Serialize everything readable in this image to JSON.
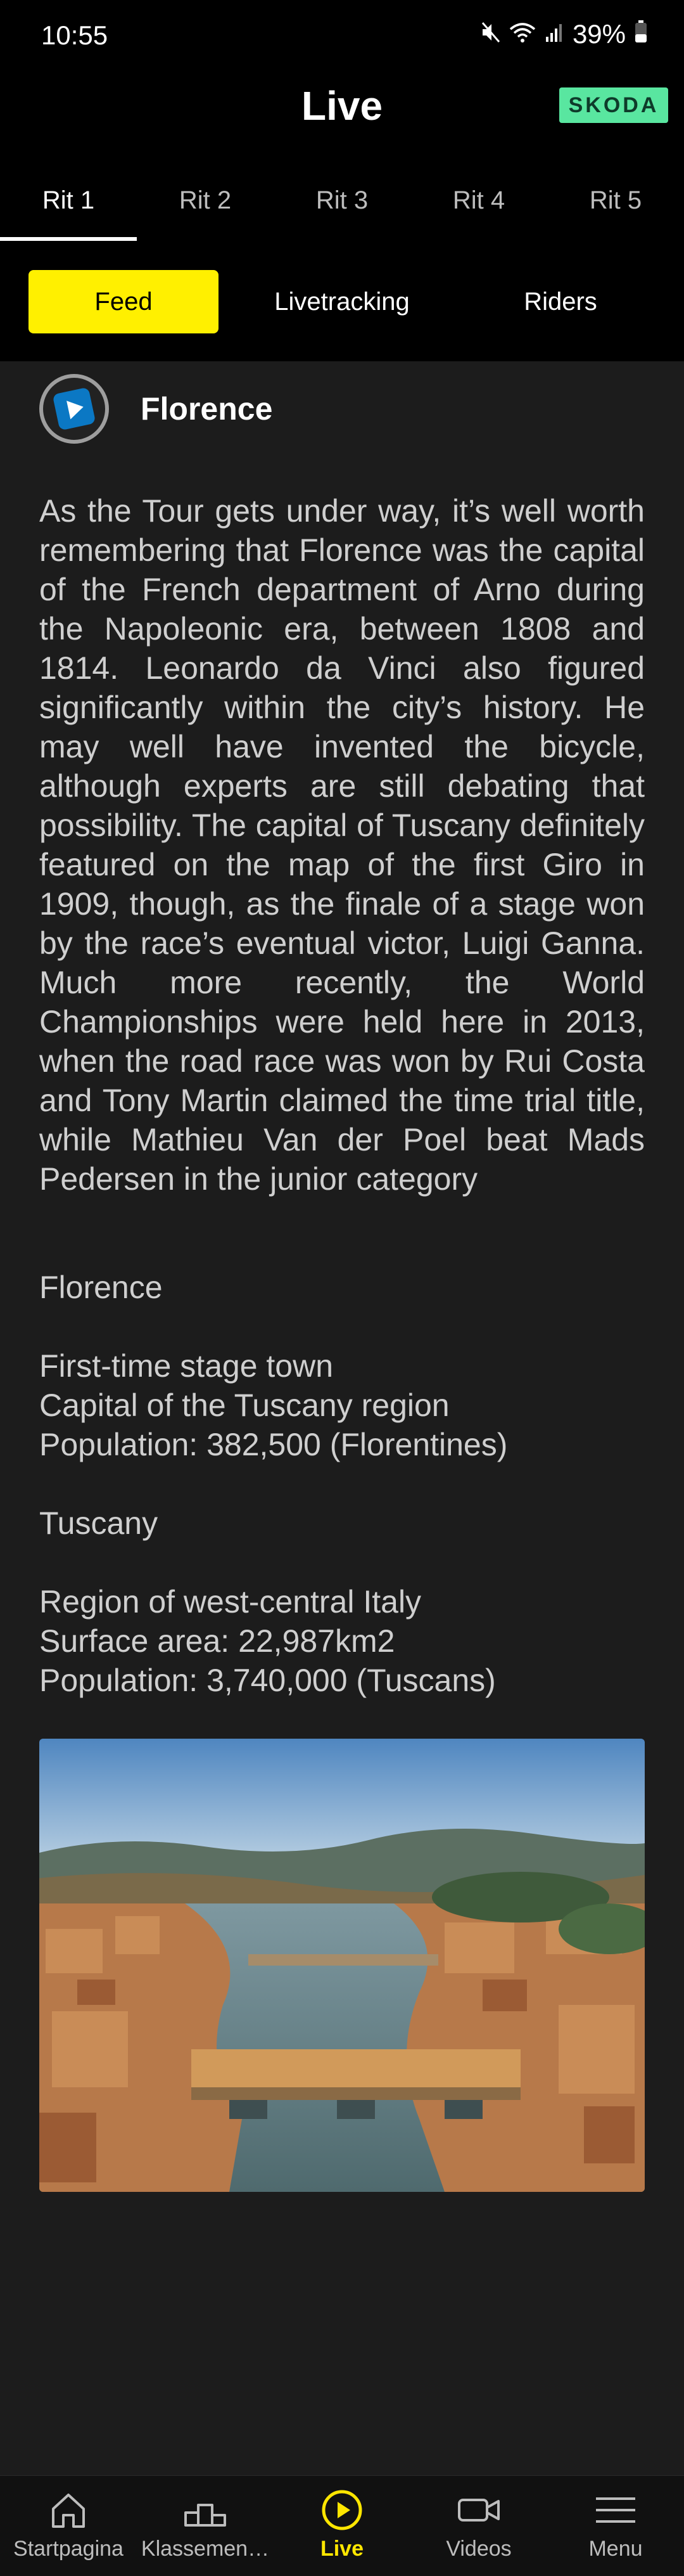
{
  "status": {
    "time": "10:55",
    "battery": "39%"
  },
  "header": {
    "title": "Live",
    "brand": "SKODA"
  },
  "stage_tabs": [
    "Rit 1",
    "Rit 2",
    "Rit 3",
    "Rit 4",
    "Rit 5"
  ],
  "segments": {
    "feed": "Feed",
    "livetracking": "Livetracking",
    "riders": "Riders"
  },
  "post": {
    "title": "Florence",
    "body": "As the Tour gets under way, it’s well worth remembering that Florence was the capital of the French department of Arno during the Napoleonic era, between 1808 and 1814. Leonardo da Vinci also figured significantly within the city’s history. He may well have invented the bicycle, although experts are still debating that possibility. The capital of Tuscany definitely featured on the map of the first Giro in 1909, though, as the finale of a stage won by the race’s eventual victor, Luigi Ganna. Much more recently, the World Championships were held here in 2013, when the road race was won by Rui Costa and Tony Martin claimed the time trial title, while Mathieu Van der Poel beat Mads Pedersen in the junior category",
    "florence_heading": "Florence",
    "florence_facts": [
      "First-time stage town",
      "Capital of the Tuscany region",
      "Population: 382,500 (Florentines)"
    ],
    "tuscany_heading": "Tuscany",
    "tuscany_facts": [
      "Region of west-central Italy",
      "Surface area: 22,987km2",
      "Population: 3,740,000 (Tuscans)"
    ]
  },
  "bottom_nav": [
    "Startpagina",
    "Klassemen…",
    "Live",
    "Videos",
    "Menu"
  ],
  "colors": {
    "accent": "#fff000",
    "brand": "#59e6a0",
    "background": "#1c1c1c"
  }
}
